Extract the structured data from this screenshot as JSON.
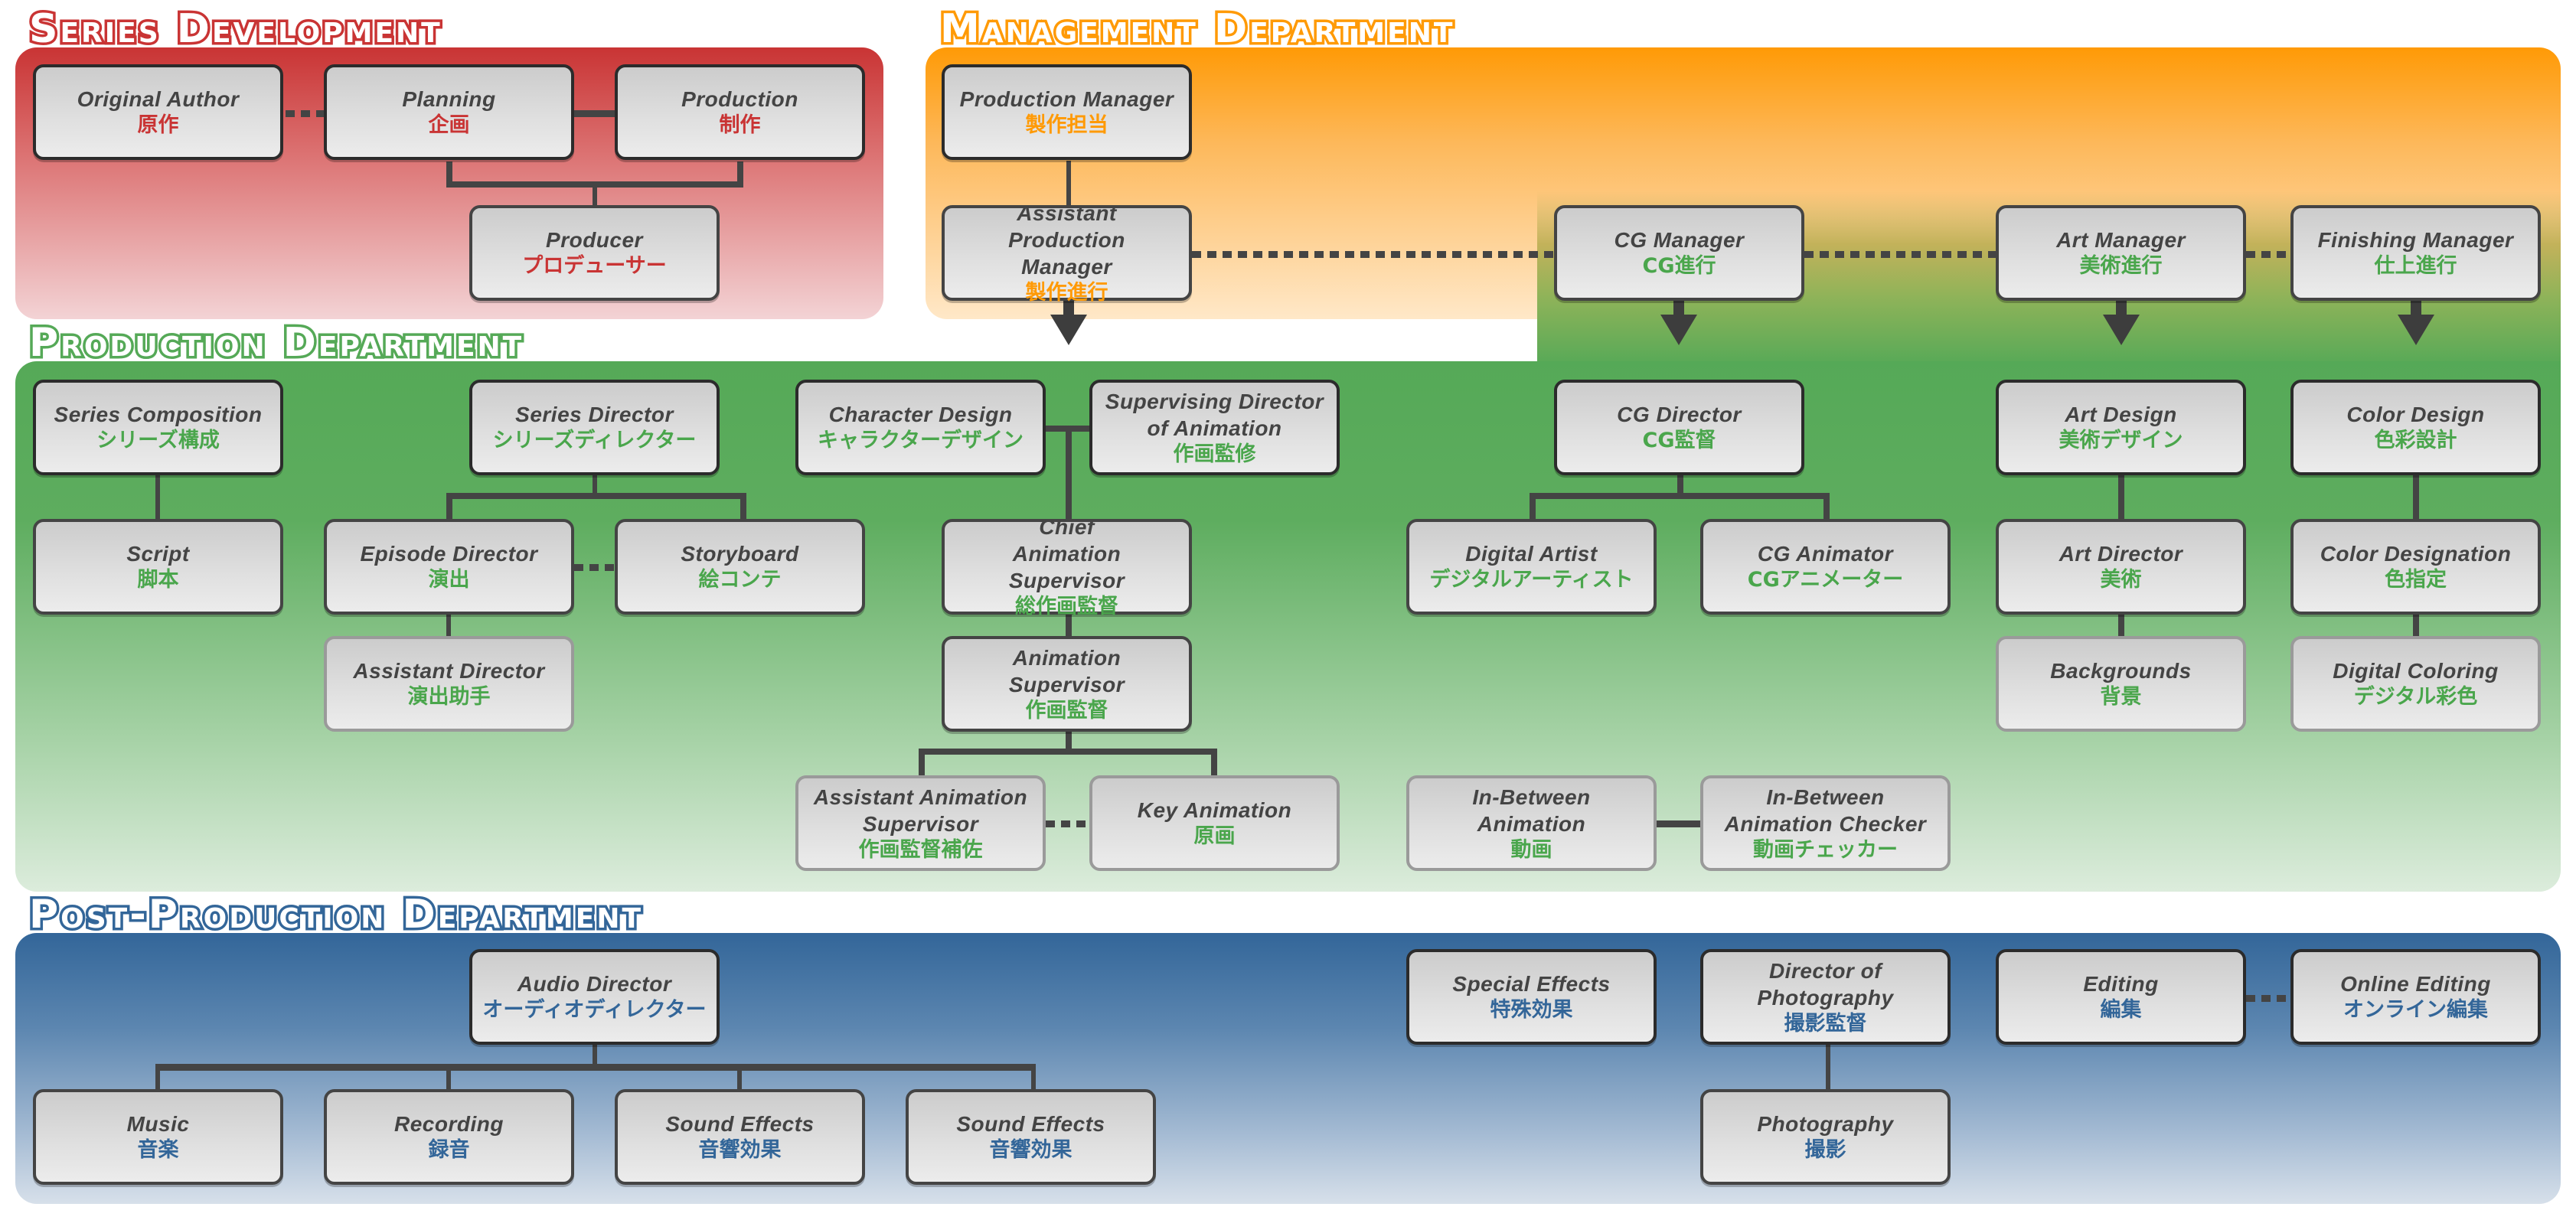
{
  "colors": {
    "series_development": "#c93434",
    "management": "#ff9a06",
    "production": "#55a957",
    "post_production": "#336699",
    "connector": "#444444"
  },
  "departments": {
    "series_development": {
      "title": "Series Development",
      "roles": {
        "original_author": {
          "en": "Original Author",
          "ja": "原作"
        },
        "planning": {
          "en": "Planning",
          "ja": "企画"
        },
        "production": {
          "en": "Production",
          "ja": "制作"
        },
        "producer": {
          "en": "Producer",
          "ja": "プロデューサー"
        }
      }
    },
    "management": {
      "title": "Management Department",
      "roles": {
        "production_manager": {
          "en": "Production Manager",
          "ja": "製作担当"
        },
        "assistant_production_manager": {
          "en": "Assistant Production Manager",
          "ja": "製作進行"
        },
        "cg_manager": {
          "en": "CG Manager",
          "ja": "CG進行"
        },
        "art_manager": {
          "en": "Art Manager",
          "ja": "美術進行"
        },
        "finishing_manager": {
          "en": "Finishing Manager",
          "ja": "仕上進行"
        }
      }
    },
    "production": {
      "title": "Production Department",
      "roles": {
        "series_composition": {
          "en": "Series Composition",
          "ja": "シリーズ構成"
        },
        "script": {
          "en": "Script",
          "ja": "脚本"
        },
        "series_director": {
          "en": "Series Director",
          "ja": "シリーズディレクター"
        },
        "episode_director": {
          "en": "Episode Director",
          "ja": "演出"
        },
        "storyboard": {
          "en": "Storyboard",
          "ja": "絵コンテ"
        },
        "assistant_director": {
          "en": "Assistant Director",
          "ja": "演出助手"
        },
        "character_design": {
          "en": "Character Design",
          "ja": "キャラクターデザイン"
        },
        "supervising_director_animation": {
          "en": "Supervising Director of Animation",
          "ja": "作画監修"
        },
        "chief_animation_supervisor": {
          "en": "Chief Animation Supervisor",
          "ja": "総作画監督"
        },
        "animation_supervisor": {
          "en": "Animation Supervisor",
          "ja": "作画監督"
        },
        "assistant_animation_supervisor": {
          "en": "Assistant Animation Supervisor",
          "ja": "作画監督補佐"
        },
        "key_animation": {
          "en": "Key Animation",
          "ja": "原画"
        },
        "cg_director": {
          "en": "CG Director",
          "ja": "CG監督"
        },
        "digital_artist": {
          "en": "Digital Artist",
          "ja": "デジタルアーティスト"
        },
        "cg_animator": {
          "en": "CG Animator",
          "ja": "CGアニメーター"
        },
        "in_between_animation": {
          "en": "In-Between Animation",
          "ja": "動画"
        },
        "in_between_checker": {
          "en": "In-Between Animation Checker",
          "ja": "動画チェッカー"
        },
        "art_design": {
          "en": "Art Design",
          "ja": "美術デザイン"
        },
        "art_director": {
          "en": "Art Director",
          "ja": "美術"
        },
        "backgrounds": {
          "en": "Backgrounds",
          "ja": "背景"
        },
        "color_design": {
          "en": "Color Design",
          "ja": "色彩設計"
        },
        "color_designation": {
          "en": "Color Designation",
          "ja": "色指定"
        },
        "digital_coloring": {
          "en": "Digital Coloring",
          "ja": "デジタル彩色"
        }
      }
    },
    "post_production": {
      "title": "Post-Production Department",
      "roles": {
        "audio_director": {
          "en": "Audio Director",
          "ja": "オーディオディレクター"
        },
        "music": {
          "en": "Music",
          "ja": "音楽"
        },
        "recording": {
          "en": "Recording",
          "ja": "録音"
        },
        "sound_effects_1": {
          "en": "Sound Effects",
          "ja": "音響効果"
        },
        "sound_effects_2": {
          "en": "Sound Effects",
          "ja": "音響効果"
        },
        "special_effects": {
          "en": "Special Effects",
          "ja": "特殊効果"
        },
        "director_of_photography": {
          "en": "Director of Photography",
          "ja": "撮影監督"
        },
        "photography": {
          "en": "Photography",
          "ja": "撮影"
        },
        "editing": {
          "en": "Editing",
          "ja": "編集"
        },
        "online_editing": {
          "en": "Online Editing",
          "ja": "オンライン編集"
        }
      }
    }
  }
}
